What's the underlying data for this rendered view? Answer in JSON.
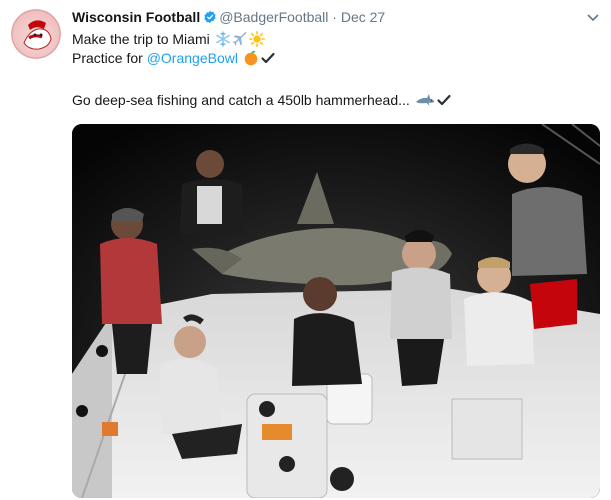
{
  "tweet": {
    "author_name": "Wisconsin Football",
    "handle": "@BadgerFootball",
    "separator": "·",
    "date": "Dec 27",
    "line1_text": "Make the trip to Miami",
    "line2_text": "Practice for ",
    "line2_mention": "@OrangeBowl",
    "line3_text": "Go deep-sea fishing and catch a 450lb hammerhead..."
  },
  "icons": {
    "avatar": "badger-mascot-avatar",
    "verified": "verified-badge-icon",
    "more": "chevron-down-icon",
    "line1_emojis": [
      "snowflake-icon",
      "airplane-icon",
      "sun-icon"
    ],
    "line2_emojis": [
      "orange-icon",
      "checkmark-icon"
    ],
    "line3_emojis": [
      "shark-icon",
      "checkmark-icon"
    ]
  },
  "colors": {
    "link": "#1da1f2",
    "verified": "#1da1f2",
    "secondary_text": "#657786"
  }
}
